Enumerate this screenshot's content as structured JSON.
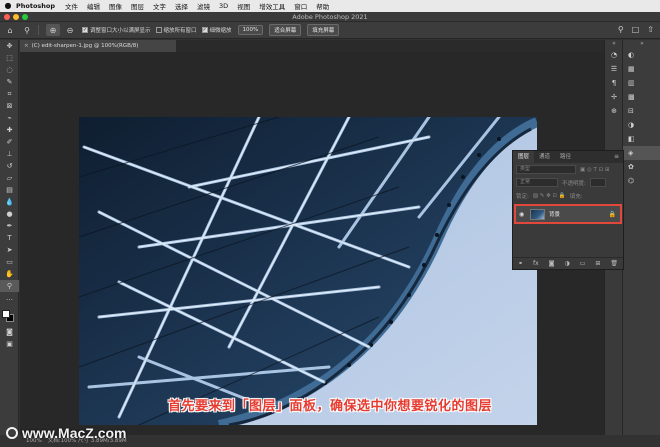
{
  "menubar": {
    "apple": "",
    "app": "Photoshop",
    "items": [
      "文件",
      "编辑",
      "图像",
      "图层",
      "文字",
      "选择",
      "滤镜",
      "3D",
      "视图",
      "增效工具",
      "窗口",
      "帮助"
    ]
  },
  "window": {
    "title": "Adobe Photoshop 2021"
  },
  "options": {
    "checkbox1": "调整窗口大小以满屏显示",
    "checkbox2": "缩放所有窗口",
    "checkbox3": "细微缩放",
    "zoom_btn": "100%",
    "fit_btn": "适合屏幕",
    "fill_btn": "填充屏幕"
  },
  "doc_tab": {
    "close": "×",
    "name": "(C) edit-sharpen-1.jpg @ 100%(RGB/8)"
  },
  "layers_panel": {
    "tabs": [
      "图层",
      "通道",
      "路径"
    ],
    "search_placeholder": "类型",
    "blend": "正常",
    "opacity": "不透明度:",
    "lock_label": "锁定:",
    "fill": "填充:",
    "layer_name": "背景"
  },
  "status": {
    "zoom": "100%",
    "doc": "文档:100% 尺寸 3.89M/3.89M"
  },
  "subtitle": "首先要来到「图层」面板，确保选中你想要锐化的图层",
  "watermark": "www.MacZ.com",
  "colors": {
    "accent": "#e2473b",
    "subtitle": "#e63b30"
  }
}
